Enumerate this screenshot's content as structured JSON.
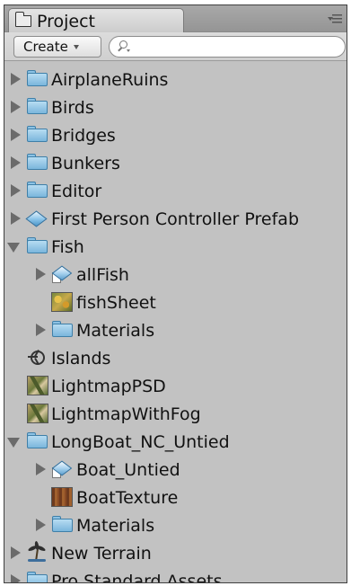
{
  "window": {
    "tab_title": "Project",
    "tab_icon": "folder-icon",
    "menu_icon": "panel-menu-icon"
  },
  "toolbar": {
    "create_label": "Create",
    "search_placeholder": "",
    "search_icon": "search-icon"
  },
  "tree": [
    {
      "label": "AirplaneRuins",
      "icon": "folder-icon",
      "depth": 0,
      "arrow": "collapsed"
    },
    {
      "label": "Birds",
      "icon": "folder-icon",
      "depth": 0,
      "arrow": "collapsed"
    },
    {
      "label": "Bridges",
      "icon": "folder-icon",
      "depth": 0,
      "arrow": "collapsed"
    },
    {
      "label": "Bunkers",
      "icon": "folder-icon",
      "depth": 0,
      "arrow": "collapsed"
    },
    {
      "label": "Editor",
      "icon": "folder-icon",
      "depth": 0,
      "arrow": "collapsed"
    },
    {
      "label": "First Person Controller Prefab",
      "icon": "prefab-icon",
      "depth": 0,
      "arrow": "collapsed"
    },
    {
      "label": "Fish",
      "icon": "folder-icon",
      "depth": 0,
      "arrow": "expanded"
    },
    {
      "label": "allFish",
      "icon": "model-icon",
      "depth": 1,
      "arrow": "collapsed"
    },
    {
      "label": "fishSheet",
      "icon": "texture-icon",
      "depth": 1,
      "arrow": "none"
    },
    {
      "label": "Materials",
      "icon": "folder-icon",
      "depth": 1,
      "arrow": "collapsed"
    },
    {
      "label": "Islands",
      "icon": "scene-icon",
      "depth": 0,
      "arrow": "none"
    },
    {
      "label": "LightmapPSD",
      "icon": "texture-icon",
      "depth": 0,
      "arrow": "none"
    },
    {
      "label": "LightmapWithFog",
      "icon": "texture-icon",
      "depth": 0,
      "arrow": "none"
    },
    {
      "label": "LongBoat_NC_Untied",
      "icon": "folder-icon",
      "depth": 0,
      "arrow": "expanded"
    },
    {
      "label": "Boat_Untied",
      "icon": "model-icon",
      "depth": 1,
      "arrow": "collapsed"
    },
    {
      "label": "BoatTexture",
      "icon": "texture-icon",
      "depth": 1,
      "arrow": "none"
    },
    {
      "label": "Materials",
      "icon": "folder-icon",
      "depth": 1,
      "arrow": "collapsed"
    },
    {
      "label": "New Terrain",
      "icon": "terrain-icon",
      "depth": 0,
      "arrow": "collapsed"
    },
    {
      "label": "Pro Standard Assets",
      "icon": "folder-icon",
      "depth": 0,
      "arrow": "collapsed"
    }
  ]
}
